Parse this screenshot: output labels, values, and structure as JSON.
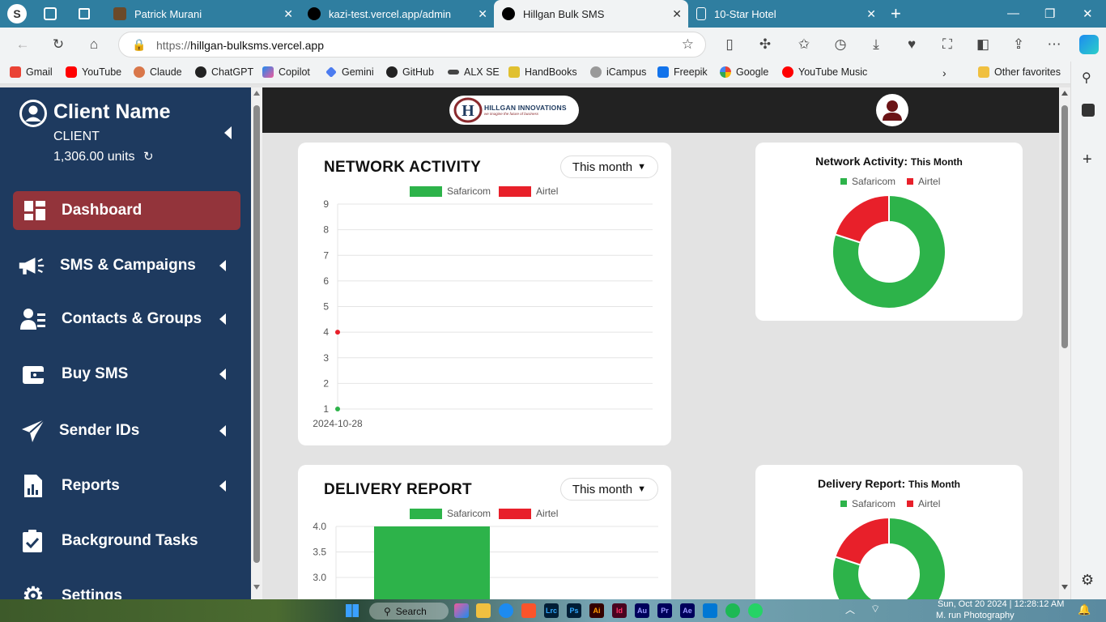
{
  "browser": {
    "tabs": [
      {
        "label": "Patrick Murani"
      },
      {
        "label": "kazi-test.vercel.app/admin"
      },
      {
        "label": "Hillgan Bulk SMS"
      },
      {
        "label": "10-Star Hotel"
      }
    ],
    "url_prefix": "https://",
    "url_host": "hillgan-bulksms.vercel.app",
    "bookmarks": [
      "Gmail",
      "YouTube",
      "Claude",
      "ChatGPT",
      "Copilot",
      "Gemini",
      "GitHub",
      "ALX SE",
      "HandBooks",
      "iCampus",
      "Freepik",
      "Google",
      "YouTube Music"
    ],
    "other_favorites": "Other favorites"
  },
  "sidebar": {
    "client_name": "Client Name",
    "client_role": "CLIENT",
    "units": "1,306.00 units",
    "items": [
      {
        "label": "Dashboard",
        "icon": "dashboard-icon"
      },
      {
        "label": "SMS & Campaigns",
        "icon": "megaphone-icon"
      },
      {
        "label": "Contacts & Groups",
        "icon": "contacts-icon"
      },
      {
        "label": "Buy SMS",
        "icon": "wallet-icon"
      },
      {
        "label": "Sender IDs",
        "icon": "paper-plane-icon"
      },
      {
        "label": "Reports",
        "icon": "report-icon"
      },
      {
        "label": "Background Tasks",
        "icon": "tasks-icon"
      },
      {
        "label": "Settings",
        "icon": "gear-icon"
      }
    ]
  },
  "header": {
    "logo_text": "HILLGAN INNOVATIONS",
    "logo_tagline": "we imagine the future of business"
  },
  "network_activity": {
    "title": "NETWORK ACTIVITY",
    "filter": "This month",
    "chart_data": {
      "type": "line",
      "categories": [
        "2024-10-28"
      ],
      "series": [
        {
          "name": "Safaricom",
          "values": [
            1
          ],
          "color": "#2db34a"
        },
        {
          "name": "Airtel",
          "values": [
            4
          ],
          "color": "#e8202a"
        }
      ],
      "ylim": [
        1,
        9
      ],
      "yticks": [
        "9",
        "8",
        "7",
        "6",
        "5",
        "4",
        "3",
        "2",
        "1"
      ],
      "legend": "top"
    }
  },
  "network_donut": {
    "title": "Network Activity:",
    "subtitle": "This Month",
    "chart_data": {
      "type": "pie",
      "labels": [
        "Safaricom",
        "Airtel"
      ],
      "values": [
        80,
        20
      ],
      "colors": [
        "#2db34a",
        "#e8202a"
      ],
      "legend": "top"
    }
  },
  "delivery_report": {
    "title": "DELIVERY REPORT",
    "filter": "This month",
    "chart_data": {
      "type": "bar",
      "series": [
        {
          "name": "Safaricom",
          "values": [
            4.0
          ],
          "color": "#2db34a"
        },
        {
          "name": "Airtel",
          "values": [
            0
          ],
          "color": "#e8202a"
        }
      ],
      "yticks": [
        "4.0",
        "3.5",
        "3.0"
      ],
      "legend": "top"
    }
  },
  "delivery_donut": {
    "title": "Delivery Report:",
    "subtitle": "This Month",
    "chart_data": {
      "type": "pie",
      "labels": [
        "Safaricom",
        "Airtel"
      ],
      "values": [
        80,
        20
      ],
      "colors": [
        "#2db34a",
        "#e8202a"
      ],
      "legend": "top"
    }
  },
  "taskbar": {
    "search": "Search",
    "clock": "Sun, Oct 20 2024 | 12:28:12 AM",
    "wallpaper_credit": "M. run Photography"
  }
}
